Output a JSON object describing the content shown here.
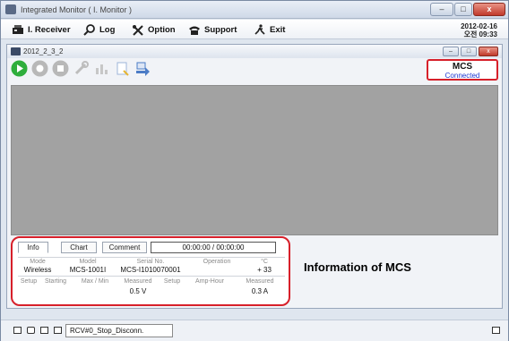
{
  "window": {
    "title": "Integrated Monitor ( I. Monitor )",
    "controls": [
      "–",
      "□",
      "x"
    ]
  },
  "menu": {
    "items": [
      {
        "label": "I. Receiver",
        "icon": "receiver-icon"
      },
      {
        "label": "Log",
        "icon": "search-icon"
      },
      {
        "label": "Option",
        "icon": "tools-icon"
      },
      {
        "label": "Support",
        "icon": "phone-icon"
      },
      {
        "label": "Exit",
        "icon": "exit-icon"
      }
    ],
    "date": "2012-02-16",
    "time": "오전 09:33"
  },
  "inner": {
    "title": "2012_2_3_2",
    "controls": [
      "–",
      "□",
      "x"
    ]
  },
  "toolbar": {
    "icons": [
      "play-icon",
      "record-icon",
      "stop-icon",
      "wrench-icon",
      "chart-icon",
      "report-icon",
      "export-icon"
    ]
  },
  "mcs": {
    "name": "MCS",
    "status": "Connected"
  },
  "info": {
    "tabs": [
      "Info",
      "Chart",
      "Comment"
    ],
    "timer": "00:00:00 / 00:00:00",
    "row1_headers": [
      "Mode",
      "Model",
      "Serial No.",
      "Operation",
      "°C"
    ],
    "row1_values": [
      "Wireless",
      "MCS-1001I",
      "MCS-I1010070001",
      "",
      "+ 33"
    ],
    "row2_headers": [
      "Setup",
      "Starting",
      "Max / Min",
      "Measured",
      "Setup",
      "Amp-Hour",
      "Measured"
    ],
    "row2_values": [
      "",
      "",
      "",
      "0.5 V",
      "",
      "",
      "0.3 A"
    ]
  },
  "caption": "Information of MCS",
  "status_bar": {
    "field": "RCV#0_Stop_Disconn."
  },
  "colors": {
    "highlight": "#d7202a",
    "connected": "#1a35d0",
    "panel_gray": "#a2a2a2"
  }
}
